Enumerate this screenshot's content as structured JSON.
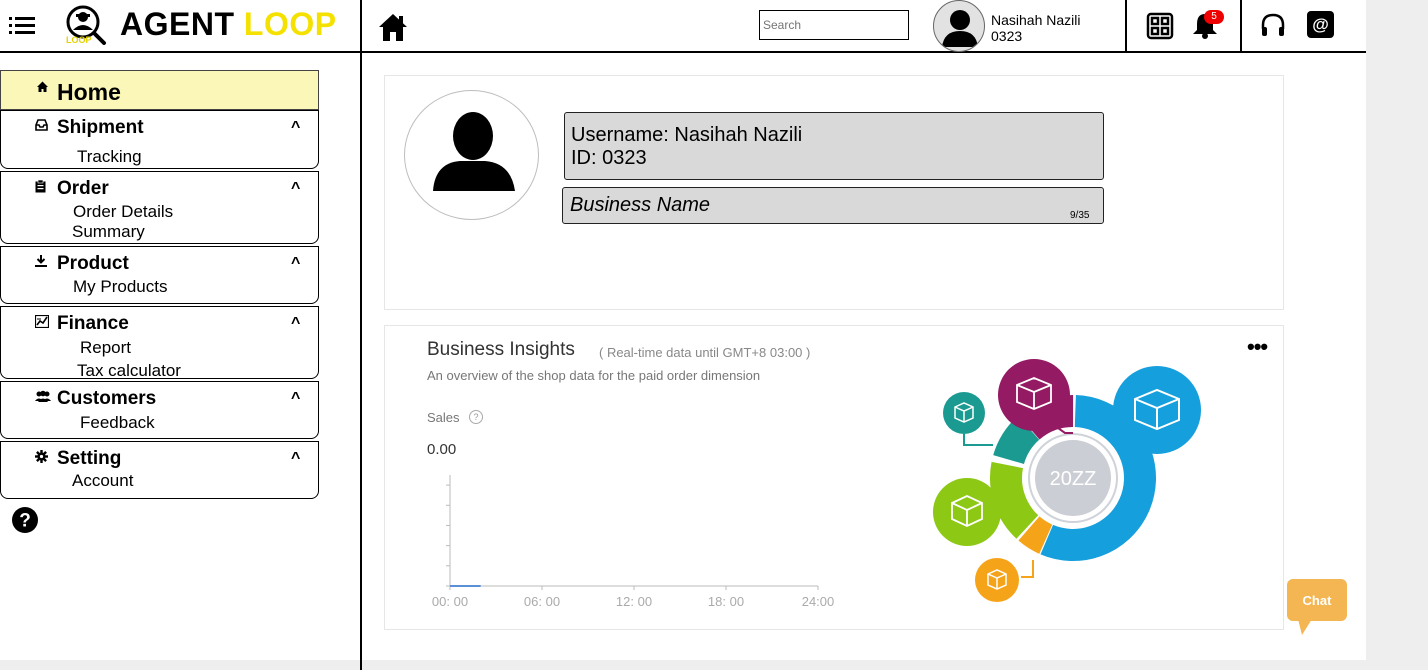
{
  "header": {
    "brand_part1": "AGENT",
    "brand_part2": "LOOP",
    "logo_subtext": "LOOP",
    "search_placeholder": "Search",
    "user_name": "Nasihah Nazili",
    "user_id": "0323",
    "notification_count": "5",
    "icons": [
      "menu-icon",
      "home-icon",
      "grid-icon",
      "bell-icon",
      "headset-icon",
      "at-icon"
    ]
  },
  "sidebar": {
    "home_label": "Home",
    "groups": [
      {
        "label": "Shipment",
        "caret": "^",
        "icon": "inbox-icon",
        "items": [
          "Tracking"
        ]
      },
      {
        "label": "Order",
        "caret": "^",
        "icon": "clipboard-icon",
        "items": [
          "Order Details",
          "Summary"
        ]
      },
      {
        "label": "Product",
        "caret": "^",
        "icon": "download-icon",
        "items": [
          "My Products"
        ]
      },
      {
        "label": "Finance",
        "caret": "^",
        "icon": "chart-icon",
        "items": [
          "Report",
          "Tax calculator"
        ]
      },
      {
        "label": "Customers",
        "caret": "^",
        "icon": "users-icon",
        "items": [
          "Feedback"
        ]
      },
      {
        "label": "Setting",
        "caret": "^",
        "icon": "gear-icon",
        "items": [
          "Account"
        ]
      }
    ]
  },
  "profile": {
    "username_line": "Username: Nasihah Nazili",
    "id_line": "ID: 0323",
    "business_name_placeholder": "Business Name",
    "char_count": "9/35"
  },
  "insights": {
    "title": "Business Insights",
    "note": "( Real-time data until GMT+8 03:00 )",
    "description": "An overview of the shop data for the paid order dimension",
    "sales_label": "Sales",
    "sales_help": "?",
    "sales_value": "0.00",
    "more": "•••",
    "graphic_center_text": "20ZZ"
  },
  "chart_data": {
    "type": "line",
    "x_tick_labels": [
      "00: 00",
      "06: 00",
      "12: 00",
      "18: 00",
      "24:00"
    ],
    "x": [
      0,
      2
    ],
    "values": [
      0,
      0
    ],
    "xlim": [
      0,
      24
    ],
    "color": "#5b8fd6"
  },
  "chat": {
    "label": "Chat",
    "color": "#f4b653"
  },
  "colors": {
    "brand_yellow": "#f5e100",
    "home_highlight": "#fbf7b9",
    "badge_red": "#e00000",
    "donut_blue": "#159fdc",
    "donut_green": "#8cc814",
    "donut_purple": "#941a63",
    "donut_teal": "#1b9a91",
    "donut_orange": "#f5a318"
  }
}
